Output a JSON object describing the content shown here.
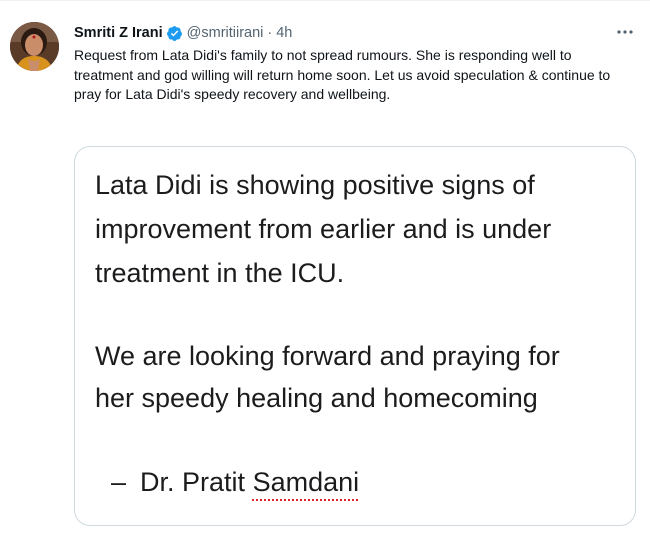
{
  "tweet": {
    "author": {
      "display_name": "Smriti Z Irani",
      "handle": "@smritiirani",
      "verified": true
    },
    "separator": "·",
    "timestamp": "4h",
    "more_icon": "ellipsis-icon",
    "text": "Request from Lata Didi's family to not spread rumours. She is responding well to treatment and god willing will return home soon. Let us avoid speculation & continue to pray for Lata Didi's speedy recovery and wellbeing.",
    "media": {
      "lines": [
        "Lata Didi is showing positive signs of",
        "improvement from earlier and  is under",
        "treatment in the ICU.",
        "We are looking forward and praying for",
        "her speedy  healing  and homecoming"
      ],
      "signature_dash": "–",
      "signature_prefix": "Dr. Pratit ",
      "signature_surname": "Samdani"
    }
  },
  "colors": {
    "verified": "#1d9bf0",
    "secondary_text": "#536471",
    "primary_text": "#0f1419",
    "card_border": "#cfd9de",
    "spellcheck": "#e0262a"
  }
}
